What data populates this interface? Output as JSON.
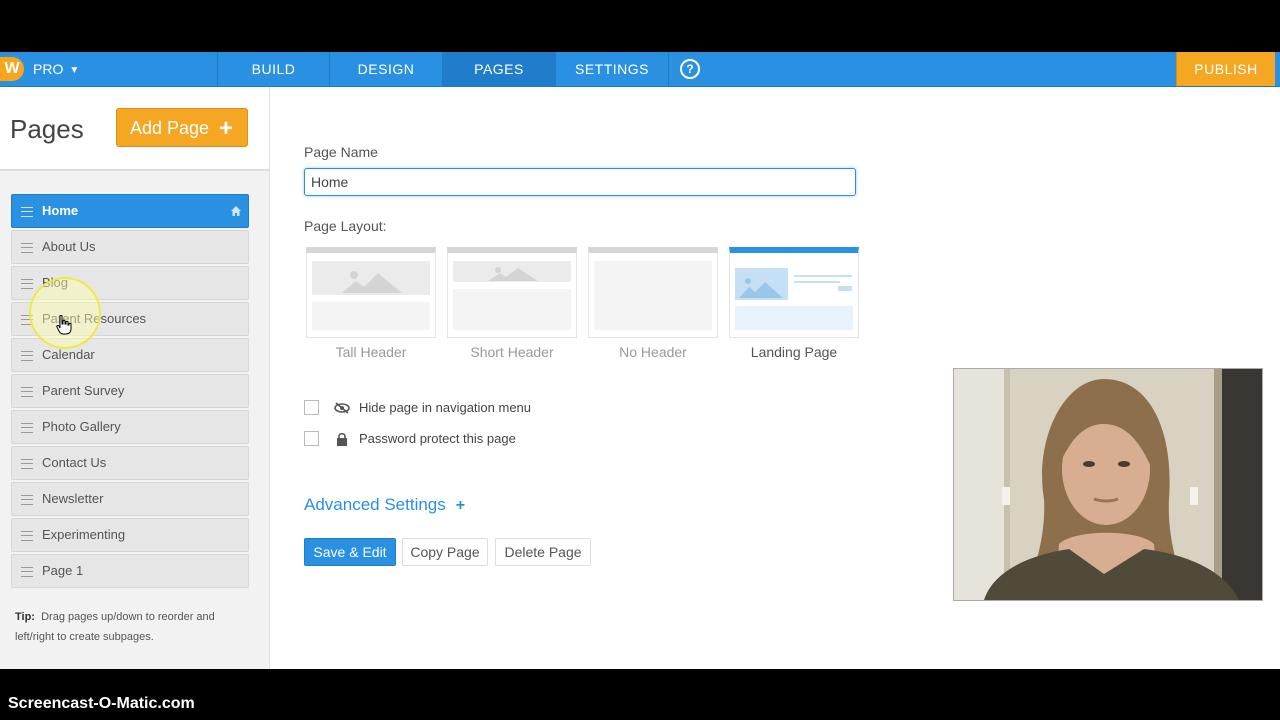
{
  "nav": {
    "logo": "W",
    "plan": "PRO",
    "tabs": [
      "BUILD",
      "DESIGN",
      "PAGES",
      "SETTINGS"
    ],
    "help": "?",
    "publish": "PUBLISH"
  },
  "sidebar": {
    "title": "Pages",
    "add_button": "Add Page",
    "add_plus": "+",
    "items": [
      {
        "label": "Home"
      },
      {
        "label": "About Us"
      },
      {
        "label": "Blog"
      },
      {
        "label": "Parent Resources"
      },
      {
        "label": "Calendar"
      },
      {
        "label": "Parent Survey"
      },
      {
        "label": "Photo Gallery"
      },
      {
        "label": "Contact Us"
      },
      {
        "label": "Newsletter"
      },
      {
        "label": "Experimenting"
      },
      {
        "label": "Page 1"
      }
    ],
    "tip_label": "Tip:",
    "tip_text": "Drag pages up/down to reorder and left/right to create subpages."
  },
  "main": {
    "page_name_label": "Page Name",
    "page_name_value": "Home",
    "layout_label": "Page Layout:",
    "layouts": [
      "Tall Header",
      "Short Header",
      "No Header",
      "Landing Page"
    ],
    "selected_layout": "Landing Page",
    "hide_option": "Hide page in navigation menu",
    "password_option": "Password protect this page",
    "advanced": "Advanced Settings",
    "advanced_plus": "+",
    "save_button": "Save & Edit",
    "copy_button": "Copy Page",
    "delete_button": "Delete Page"
  },
  "overlay": {
    "brand": "Screencast-O-Matic.com"
  },
  "colors": {
    "accent": "#2990e2",
    "orange": "#f5a623"
  }
}
